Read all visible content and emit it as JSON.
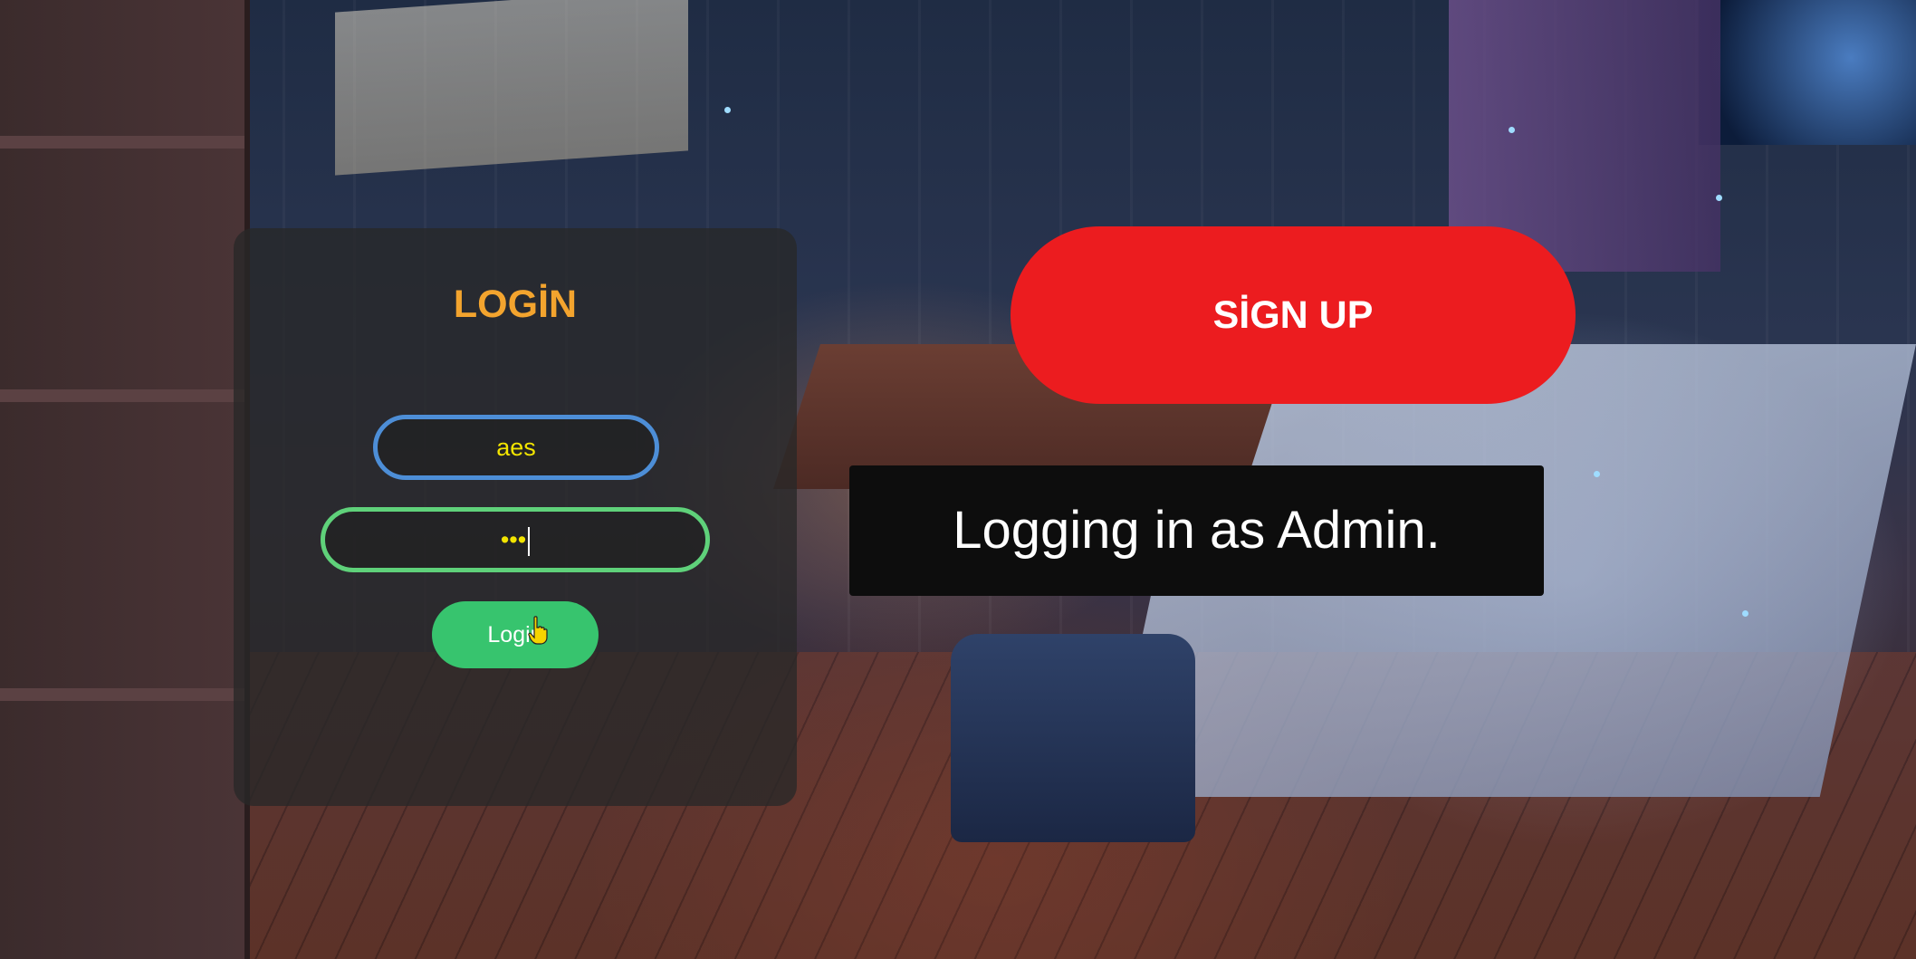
{
  "login": {
    "title": "LOGİN",
    "username_value": "aes",
    "password_mask": "•••",
    "button_label": "Login"
  },
  "signup": {
    "button_label": "SİGN UP"
  },
  "toast": {
    "message": "Logging in as Admin."
  },
  "colors": {
    "title": "#f3a42e",
    "username_border": "#4d8ed7",
    "password_border": "#5fd17a",
    "login_button": "#37c46e",
    "signup_button": "#ec1c1f",
    "field_text": "#f2e400"
  },
  "icons": {
    "cursor": "hand-pointer-icon"
  }
}
